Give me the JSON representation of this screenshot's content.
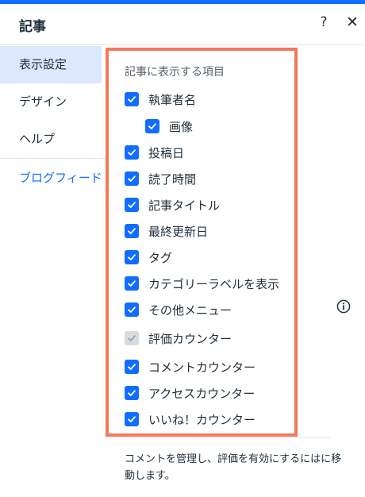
{
  "header": {
    "title": "記事",
    "help_label": "?",
    "close_label": "✕"
  },
  "sidebar": {
    "items": [
      {
        "label": "表示設定"
      },
      {
        "label": "デザイン"
      },
      {
        "label": "ヘルプ"
      }
    ],
    "link_label": "ブログフィード"
  },
  "panel": {
    "heading": "記事に表示する項目",
    "options": [
      {
        "label": "執筆者名",
        "checked": true
      },
      {
        "label": "画像",
        "checked": true
      },
      {
        "label": "投稿日",
        "checked": true
      },
      {
        "label": "読了時間",
        "checked": true
      },
      {
        "label": "記事タイトル",
        "checked": true
      },
      {
        "label": "最終更新日",
        "checked": true
      },
      {
        "label": "タグ",
        "checked": true
      },
      {
        "label": "カテゴリーラベルを表示",
        "checked": true
      },
      {
        "label": "その他メニュー",
        "checked": true
      },
      {
        "label": "評価カウンター",
        "checked": true,
        "disabled": true
      },
      {
        "label": "コメントカウンター",
        "checked": true
      },
      {
        "label": "アクセスカウンター",
        "checked": true
      },
      {
        "label": "いいね！カウンター",
        "checked": true
      }
    ]
  },
  "footer": {
    "note": "コメントを管理し、評価を有効にするにはに移動します。"
  },
  "colors": {
    "accent": "#116dff",
    "highlight_border": "#f4785b",
    "active_nav_bg": "#dce8fe"
  }
}
